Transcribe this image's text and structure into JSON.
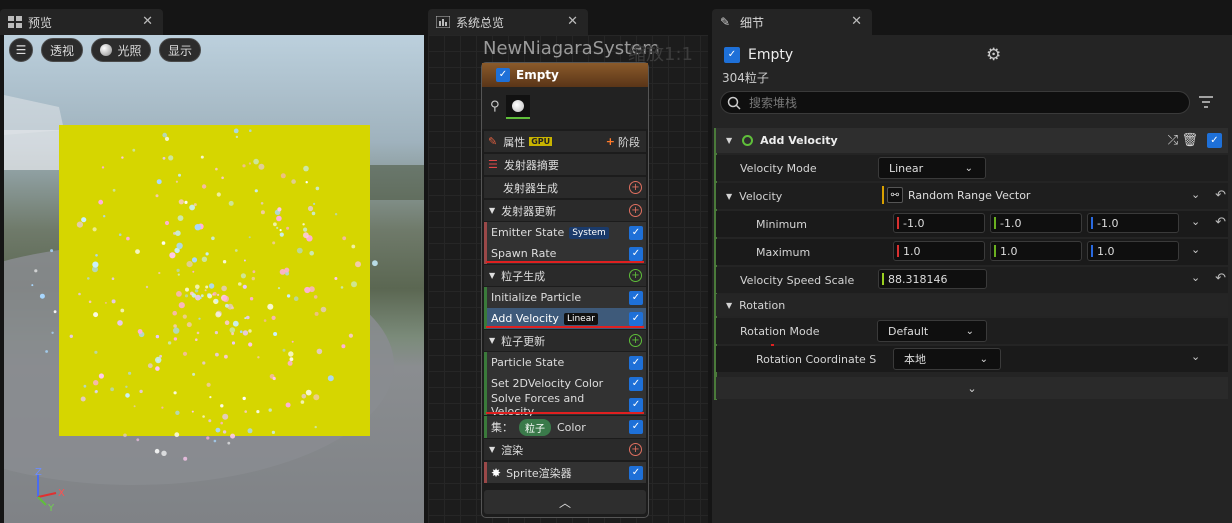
{
  "preview": {
    "tab_title": "预览",
    "btn_perspective": "透视",
    "btn_lighting": "光照",
    "btn_show": "显示",
    "axis": {
      "z": "Z",
      "x": "X",
      "y": "Y"
    }
  },
  "overview": {
    "tab_title": "系统总览",
    "system_name": "NewNiagaraSystem",
    "zoom_label": "缩放1:1",
    "emitter": {
      "name": "Empty",
      "properties_label": "属性",
      "gpu_badge": "GPU",
      "stage_label": "阶段",
      "summary_label": "发射器摘要",
      "spawn_label": "发射器生成",
      "update_label": "发射器更新",
      "emitter_state": "Emitter State",
      "emitter_state_badge": "System",
      "spawn_rate": "Spawn Rate",
      "particle_spawn_label": "粒子生成",
      "initialize_particle": "Initialize Particle",
      "add_velocity": "Add Velocity",
      "add_velocity_badge": "Linear",
      "particle_update_label": "粒子更新",
      "particle_state": "Particle State",
      "set_color": "Set 2DVelocity Color",
      "solve_forces": "Solve Forces and Velocity",
      "set_label": "集：",
      "set_badge": "粒子",
      "set_value": "Color",
      "render_label": "渲染",
      "sprite_renderer": "Sprite渲染器"
    }
  },
  "details": {
    "tab_title": "细节",
    "emitter_name": "Empty",
    "particle_count": "304粒子",
    "search_placeholder": "搜索堆栈",
    "section_title": "Add Velocity",
    "velocity_mode_label": "Velocity Mode",
    "velocity_mode_value": "Linear",
    "velocity_label": "Velocity",
    "velocity_value": "Random Range Vector",
    "minimum_label": "Minimum",
    "min_x": "-1.0",
    "min_y": "-1.0",
    "min_z": "-1.0",
    "maximum_label": "Maximum",
    "max_x": "1.0",
    "max_y": "1.0",
    "max_z": "1.0",
    "speed_scale_label": "Velocity Speed Scale",
    "speed_scale_value": "88.318146",
    "rotation_label": "Rotation",
    "rotation_mode_label": "Rotation Mode",
    "rotation_mode_value": "Default",
    "rotation_coord_label": "Rotation Coordinate S",
    "rotation_coord_value": "本地"
  }
}
